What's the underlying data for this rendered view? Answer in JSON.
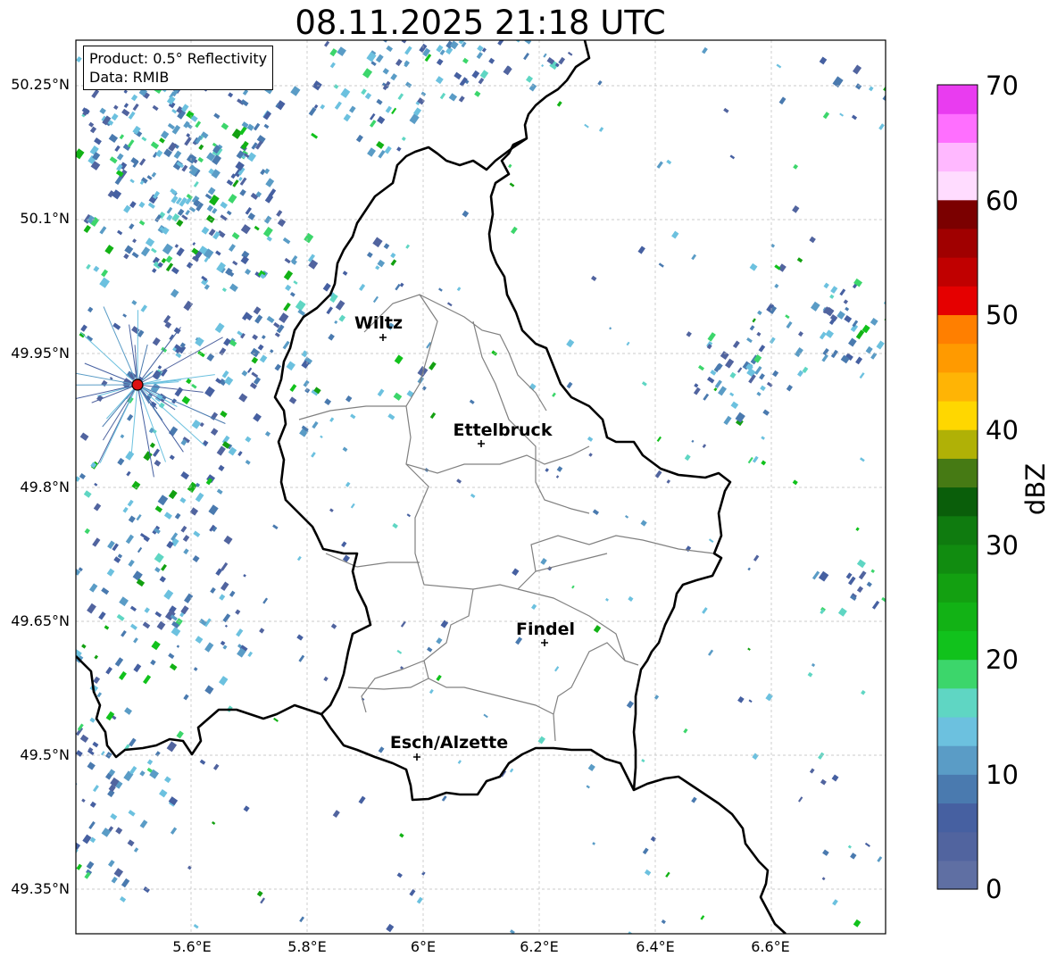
{
  "title": "08.11.2025 21:18 UTC",
  "info": {
    "product": "Product: 0.5° Reflectivity",
    "data": "Data: RMIB"
  },
  "axes": {
    "lat_ticks": [
      "50.25°N",
      "50.1°N",
      "49.95°N",
      "49.8°N",
      "49.65°N",
      "49.5°N",
      "49.35°N"
    ],
    "lon_ticks": [
      "5.6°E",
      "5.8°E",
      "6°E",
      "6.2°E",
      "6.4°E",
      "6.6°E"
    ]
  },
  "cities": [
    {
      "name": "Wiltz"
    },
    {
      "name": "Ettelbruck"
    },
    {
      "name": "Findel"
    },
    {
      "name": "Esch/Alzette"
    }
  ],
  "colorbar": {
    "unit": "dBZ",
    "tick_labels": [
      "70",
      "60",
      "50",
      "40",
      "30",
      "20",
      "10",
      "0"
    ],
    "colors": [
      "#5f6fa3",
      "#51649f",
      "#4660a1",
      "#4a7aaf",
      "#5a9cc6",
      "#6cc1df",
      "#5fd6c3",
      "#3cd66b",
      "#11c21c",
      "#12b215",
      "#13a011",
      "#118c10",
      "#0f7b0f",
      "#0a5e0a",
      "#467a14",
      "#b0b106",
      "#ffd700",
      "#ffb405",
      "#ff9a00",
      "#ff7f00",
      "#e50000",
      "#c00000",
      "#a00000",
      "#7b0000",
      "#ffdcff",
      "#ffb8ff",
      "#ff6fff",
      "#e93cf0"
    ],
    "min": 0,
    "max": 70
  },
  "colors": {
    "border": "#000000",
    "canton_lines": "#808080",
    "radar_site": "#dd1111",
    "grid": "#bbbbbb"
  }
}
